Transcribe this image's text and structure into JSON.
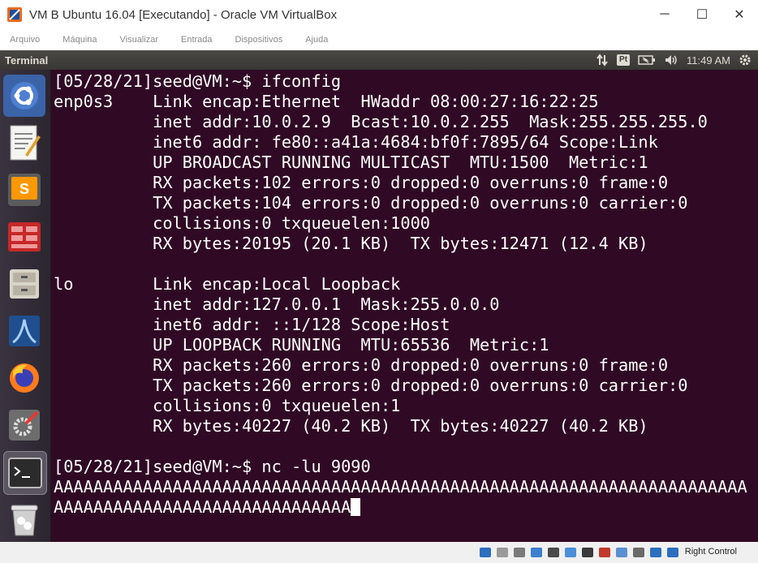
{
  "window": {
    "title": "VM B Ubuntu 16.04 [Executando] - Oracle VM VirtualBox",
    "minimize_icon": "─",
    "maximize_icon": "☐",
    "close_icon": "✕"
  },
  "menu": [
    "Arquivo",
    "Máquina",
    "Visualizar",
    "Entrada",
    "Dispositivos",
    "Ajuda"
  ],
  "panel": {
    "app_title": "Terminal",
    "keyboard_layout": "Pt",
    "time": "11:49 AM"
  },
  "launcher": [
    "ubuntu-dash",
    "text-editor",
    "sublime-text",
    "spreadsheet",
    "file-manager",
    "wireshark",
    "firefox",
    "system-settings",
    "terminal",
    "trash"
  ],
  "terminal": {
    "lines": [
      "[05/28/21]seed@VM:~$ ifconfig",
      "enp0s3    Link encap:Ethernet  HWaddr 08:00:27:16:22:25",
      "          inet addr:10.0.2.9  Bcast:10.0.2.255  Mask:255.255.255.0",
      "          inet6 addr: fe80::a41a:4684:bf0f:7895/64 Scope:Link",
      "          UP BROADCAST RUNNING MULTICAST  MTU:1500  Metric:1",
      "          RX packets:102 errors:0 dropped:0 overruns:0 frame:0",
      "          TX packets:104 errors:0 dropped:0 overruns:0 carrier:0",
      "          collisions:0 txqueuelen:1000",
      "          RX bytes:20195 (20.1 KB)  TX bytes:12471 (12.4 KB)",
      "",
      "lo        Link encap:Local Loopback",
      "          inet addr:127.0.0.1  Mask:255.0.0.0",
      "          inet6 addr: ::1/128 Scope:Host",
      "          UP LOOPBACK RUNNING  MTU:65536  Metric:1",
      "          RX packets:260 errors:0 dropped:0 overruns:0 frame:0",
      "          TX packets:260 errors:0 dropped:0 overruns:0 carrier:0",
      "          collisions:0 txqueuelen:1",
      "          RX bytes:40227 (40.2 KB)  TX bytes:40227 (40.2 KB)",
      "",
      "[05/28/21]seed@VM:~$ nc -lu 9090",
      "AAAAAAAAAAAAAAAAAAAAAAAAAAAAAAAAAAAAAAAAAAAAAAAAAAAAAAAAAAAAAAAAAAAAAA",
      "AAAAAAAAAAAAAAAAAAAAAAAAAAAAAA"
    ]
  },
  "statusbar": {
    "host_key": "Right Control",
    "icons": [
      "hard-disk-icon",
      "optical-drive-icon",
      "audio-icon",
      "network-icon",
      "usb-icon",
      "shared-folders-icon",
      "display-icon",
      "recording-icon",
      "video-capture-icon",
      "mouse-integration-icon",
      "keyboard-capture-icon",
      "arrow-down-icon"
    ]
  },
  "colors": {
    "terminal_bg": "#300a24",
    "terminal_fg": "#ffffff",
    "panel_bg": "#3c3b37",
    "launcher_bg": "#2f2a33"
  }
}
